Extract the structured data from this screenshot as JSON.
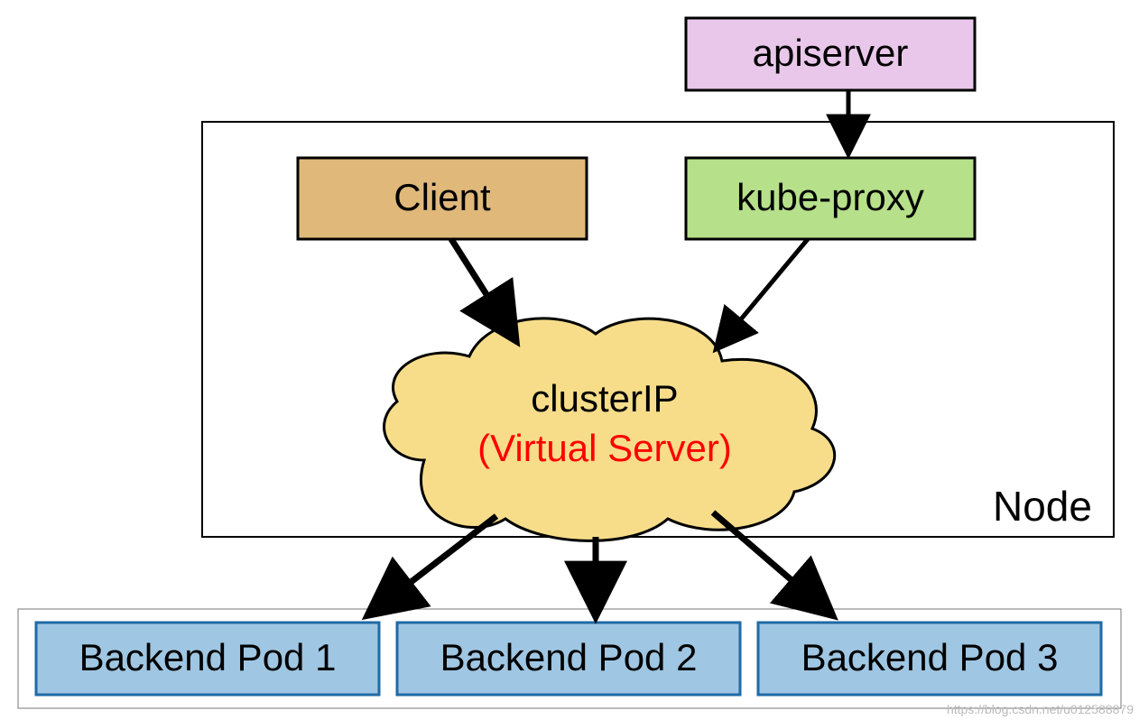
{
  "boxes": {
    "apiserver": {
      "label": "apiserver",
      "fill": "#e9c7ea",
      "stroke": "#000000"
    },
    "client": {
      "label": "Client",
      "fill": "#e0b97a",
      "stroke": "#000000"
    },
    "kubeproxy": {
      "label": "kube-proxy",
      "fill": "#b6e08a",
      "stroke": "#000000"
    },
    "node": {
      "label": "Node"
    },
    "cluster": {
      "title": "clusterIP",
      "subtitle": "(Virtual Server)",
      "fill": "#f7dd8a",
      "stroke": "#000000",
      "subtitle_color": "#ff0000"
    },
    "pod1": {
      "label": "Backend Pod 1",
      "fill": "#9fc6e2",
      "stroke": "#1f6aa5"
    },
    "pod2": {
      "label": "Backend Pod 2",
      "fill": "#9fc6e2",
      "stroke": "#1f6aa5"
    },
    "pod3": {
      "label": "Backend Pod 3",
      "fill": "#9fc6e2",
      "stroke": "#1f6aa5"
    }
  },
  "edges": [
    {
      "from": "apiserver",
      "to": "kubeproxy"
    },
    {
      "from": "client",
      "to": "clusterIP"
    },
    {
      "from": "kubeproxy",
      "to": "clusterIP"
    },
    {
      "from": "clusterIP",
      "to": "pod1"
    },
    {
      "from": "clusterIP",
      "to": "pod2"
    },
    {
      "from": "clusterIP",
      "to": "pod3"
    }
  ],
  "watermark": "https://blog.csdn.net/u012588879"
}
